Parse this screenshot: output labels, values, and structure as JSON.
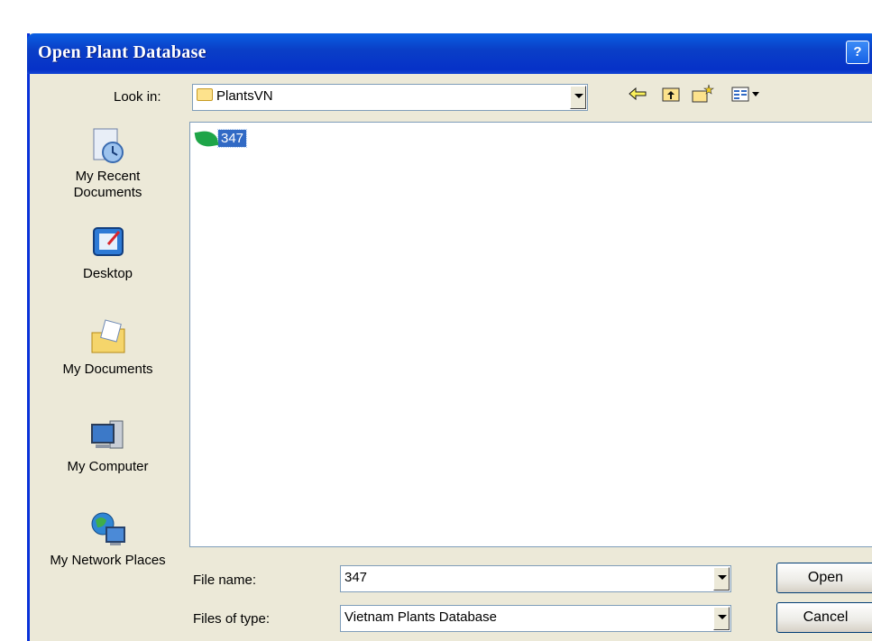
{
  "window": {
    "title": "Open Plant Database",
    "help_label": "?"
  },
  "look_in": {
    "label": "Look in:",
    "value": "PlantsVN"
  },
  "toolbar": {
    "icons": [
      "back-icon",
      "up-folder-icon",
      "new-folder-icon",
      "view-menu-icon"
    ]
  },
  "places": [
    {
      "label": "My Recent Documents",
      "icon": "recent-documents-icon"
    },
    {
      "label": "Desktop",
      "icon": "desktop-icon"
    },
    {
      "label": "My Documents",
      "icon": "my-documents-icon"
    },
    {
      "label": "My Computer",
      "icon": "my-computer-icon"
    },
    {
      "label": "My Network Places",
      "icon": "network-places-icon"
    }
  ],
  "files": [
    {
      "name": "347",
      "icon": "leaf-icon",
      "selected": true
    }
  ],
  "file_name": {
    "label": "File name:",
    "value": "347"
  },
  "file_type": {
    "label": "Files of type:",
    "value": "Vietnam Plants Database"
  },
  "buttons": {
    "open": "Open",
    "cancel": "Cancel"
  }
}
